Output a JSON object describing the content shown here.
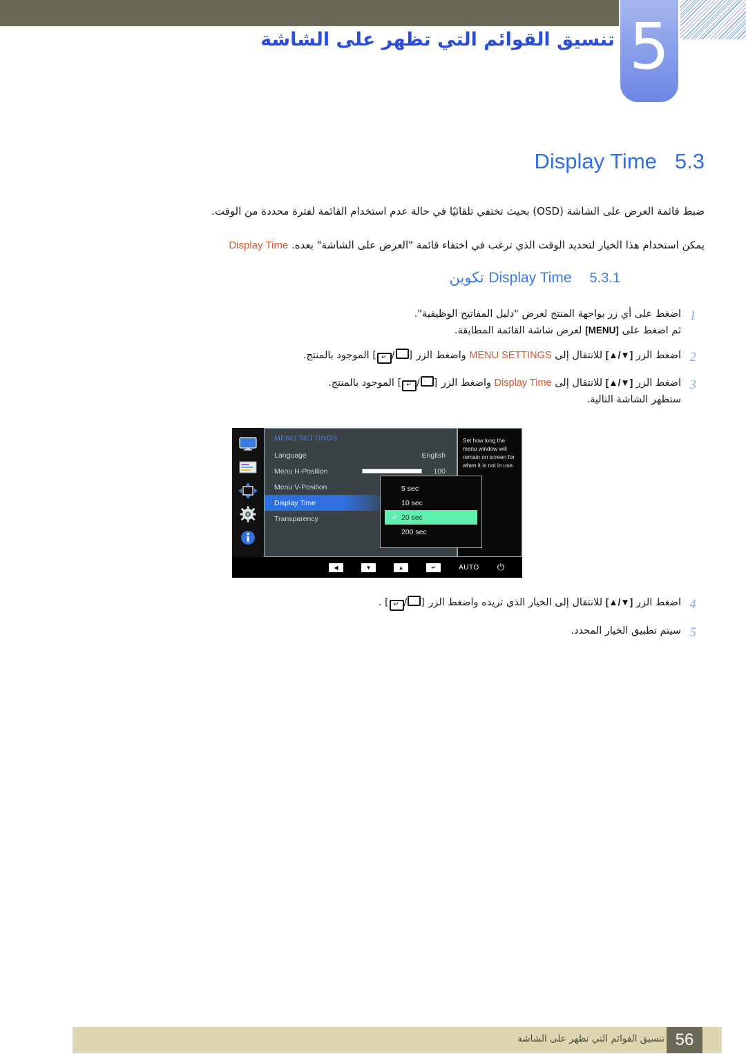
{
  "header": {
    "chapter_number": "5",
    "chapter_title": "تنسيق القوائم التي تظهر على الشاشة"
  },
  "section": {
    "number": "5.3",
    "title": "Display Time"
  },
  "paragraphs": {
    "p1": "ضبط قائمة العرض على الشاشة (OSD) بحيث تختفي تلقائيًا في حالة عدم استخدام القائمة لفترة محددة من الوقت.",
    "p2_lead": "Display Time",
    "p2_rest": "يمكن استخدام هذا الخيار لتحديد الوقت الذي ترغب في اختفاء قائمة \"العرض على الشاشة\" بعده."
  },
  "subsection": {
    "number": "5.3.1",
    "title_ar": "تكوين",
    "title_en": "Display Time"
  },
  "steps": [
    {
      "num": "1",
      "line1": "اضغط على أي زر بواجهة المنتج لعرض \"دليل المفاتيح الوظيفية\".",
      "line2_pre": "ثم اضغط على",
      "line2_key": "[MENU]",
      "line2_post": "لعرض شاشة القائمة المطابقة."
    },
    {
      "num": "2",
      "line1_a": "اضغط الزر",
      "line1_key1": "[▲/▼]",
      "line1_b": "للانتقال إلى",
      "line1_menu": "MENU SETTINGS",
      "line1_c": "واضغط الزر",
      "line1_d": "الموجود بالمنتج."
    },
    {
      "num": "3",
      "line1_a": "اضغط الزر",
      "line1_key1": "[▲/▼]",
      "line1_b": "للانتقال إلى",
      "line1_menu": "Display Time",
      "line1_c": "واضغط الزر",
      "line1_d": "الموجود بالمنتج.",
      "line2": "ستظهر الشاشة التالية."
    },
    {
      "num": "4",
      "line1_a": "اضغط الزر",
      "line1_key1": "[▲/▼]",
      "line1_b": "للانتقال إلى الخيار الذي تريده واضغط الزر",
      "line1_c": "."
    },
    {
      "num": "5",
      "line1": "سيتم تطبيق الخيار المحدد."
    }
  ],
  "osd": {
    "heading": "MENU SETTINGS",
    "rows": [
      {
        "label": "Language",
        "value": "English"
      },
      {
        "label": "Menu H-Position",
        "value": "100"
      },
      {
        "label": "Menu V-Position",
        "value": ""
      },
      {
        "label": "Display Time",
        "value": ""
      },
      {
        "label": "Transparency",
        "value": ""
      }
    ],
    "help_text": "Set how long the menu window will remain on screen for when it is not in use.",
    "popup_items": [
      {
        "label": "5 sec",
        "selected": false
      },
      {
        "label": "10 sec",
        "selected": false
      },
      {
        "label": "20 sec",
        "selected": true
      },
      {
        "label": "200 sec",
        "selected": false
      }
    ],
    "controls": {
      "left": "◀",
      "down": "▼",
      "up": "▲",
      "enter": "↵",
      "auto": "AUTO",
      "power": "⏻"
    }
  },
  "footer": {
    "text": "تنسيق القوائم التي تظهر على الشاشة",
    "page": "56"
  },
  "colors": {
    "olive": "#6b6a56",
    "accent_blue": "#2f6fe8",
    "orange": "#d9552a",
    "footer_tan": "#ddd6b0",
    "osd_select": "#2f6fe0",
    "osd_green": "#5ff0b0"
  }
}
